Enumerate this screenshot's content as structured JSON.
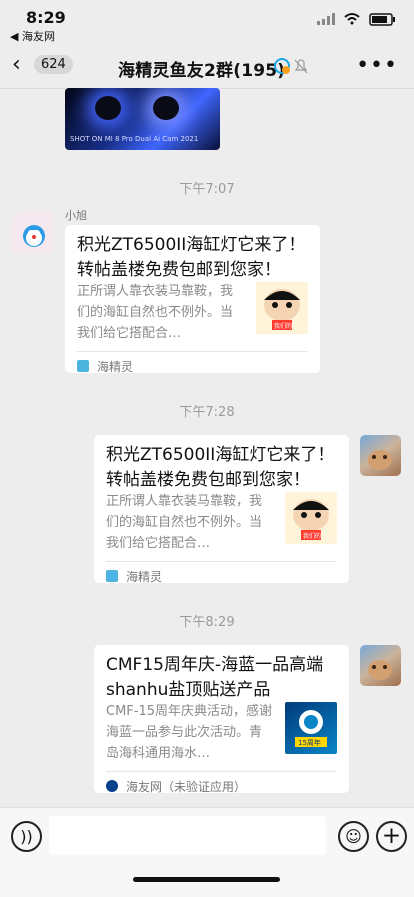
{
  "status": {
    "time": "8:29",
    "back_app": "◀ 海友网"
  },
  "nav": {
    "back_symbol": "‹",
    "unread_count": "624",
    "title": "海精灵鱼友2群(195)",
    "more_symbol": "•••"
  },
  "image_stamp": "SHOT ON MI 8 Pro\nDual Ai Cam\n2021",
  "messages": [
    {
      "time": "下午7:07",
      "sender": "小旭",
      "title_1": "积光ZT6500II海缸灯它来了！",
      "title_2": "转帖盖楼免费包邮到您家！",
      "desc": "正所谓人靠衣装马靠鞍，我们的海缸自然也不例外。当我们给它搭配合…",
      "source": "海精灵",
      "thumb_caption": "我们的"
    },
    {
      "time": "下午7:28",
      "title_1": "积光ZT6500II海缸灯它来了！",
      "title_2": "转帖盖楼免费包邮到您家！",
      "desc": "正所谓人靠衣装马靠鞍，我们的海缸自然也不例外。当我们给它搭配合…",
      "source": "海精灵",
      "thumb_caption": "我们的"
    },
    {
      "time": "下午8:29",
      "title_1": "CMF15周年庆-海蓝一品高端",
      "title_2": "shanhu盐顶贴送产品",
      "desc": "CMF-15周年庆典活动，感谢海蓝一品参与此次活动。青岛海科通用海水…",
      "source": "海友网（未验证应用）",
      "thumb_caption": "15周年"
    }
  ],
  "input": {
    "voice_symbol": "))",
    "emoji_symbol": "☺",
    "plus_symbol": "+"
  },
  "colors": {
    "background": "#ededed",
    "bubble": "#ffffff",
    "muted_text": "#8a8a8a",
    "accent": "#41b6dc"
  }
}
